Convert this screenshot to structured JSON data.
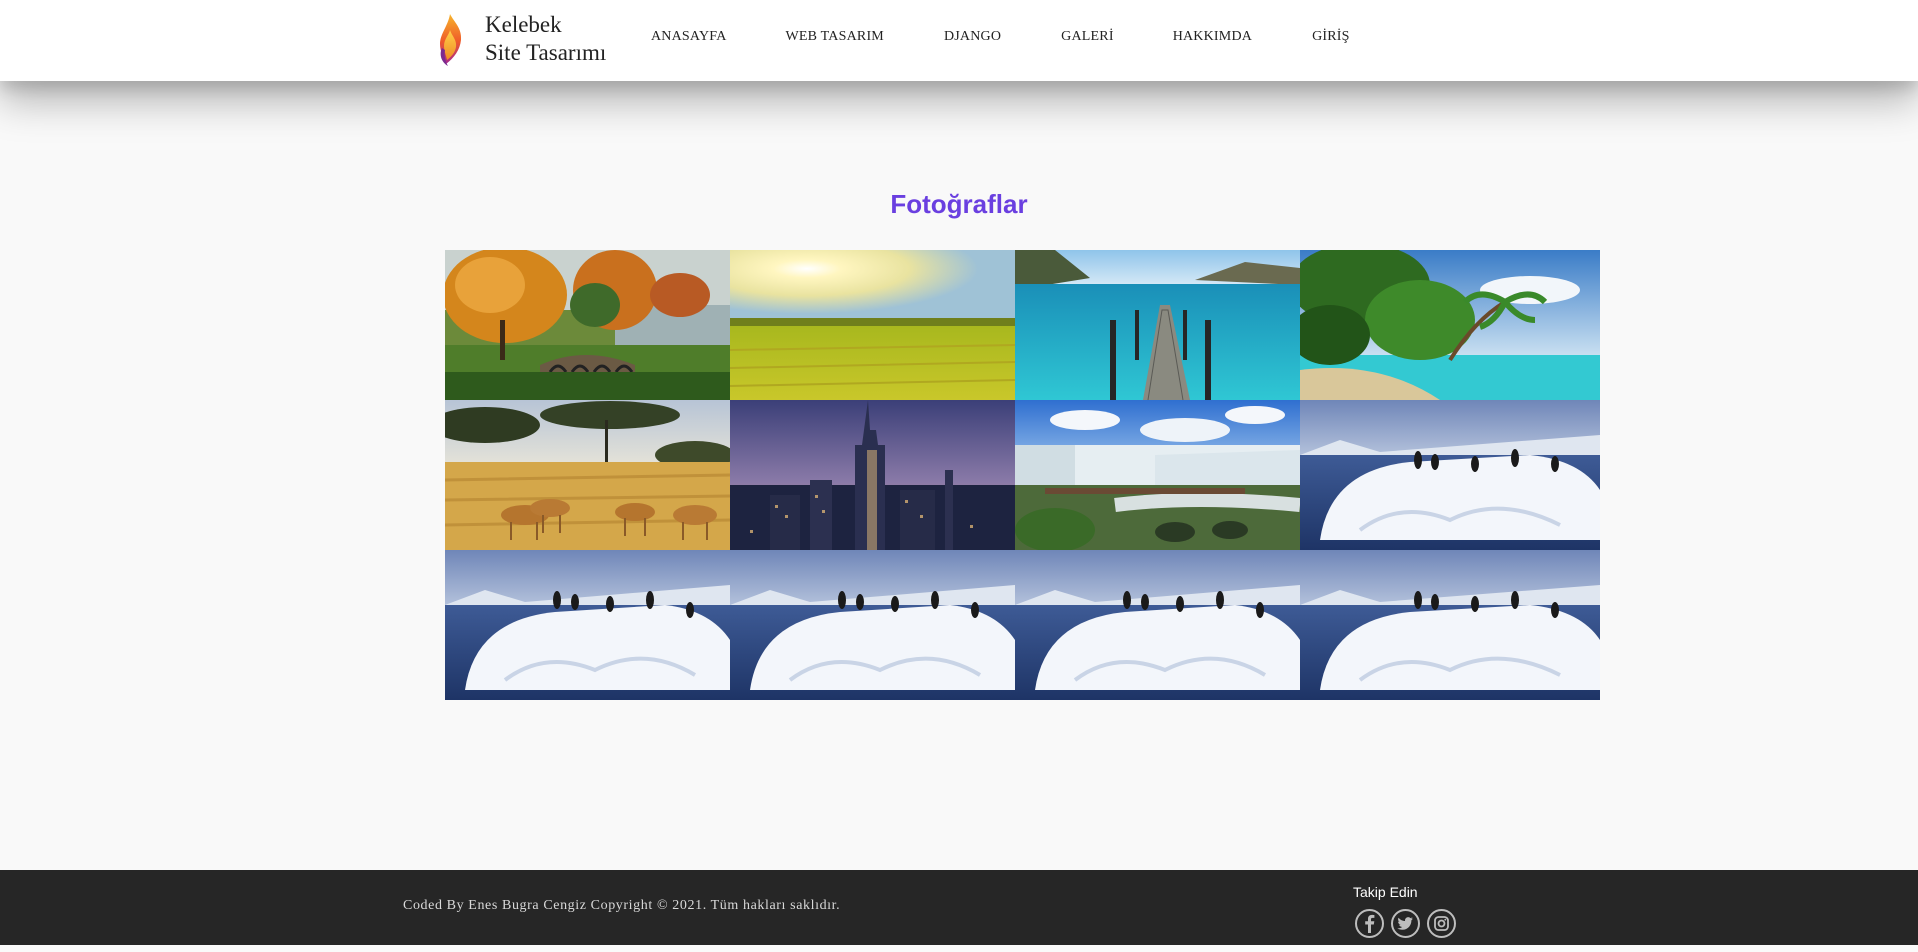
{
  "header": {
    "brand_line1": "Kelebek",
    "brand_line2": "Site Tasarımı",
    "logo_icon": "flame-logo-icon",
    "nav": [
      {
        "label": "ANASAYFA"
      },
      {
        "label": "WEB TASARIM"
      },
      {
        "label": "DJANGO"
      },
      {
        "label": "GALERİ"
      },
      {
        "label": "HAKKIMDA"
      },
      {
        "label": "GİRİŞ"
      }
    ]
  },
  "main": {
    "title": "Fotoğraflar",
    "title_color": "#6a3fe0",
    "photos": [
      {
        "scene": "autumn-park-bridge"
      },
      {
        "scene": "sunny-wheat-field"
      },
      {
        "scene": "lake-wooden-pier"
      },
      {
        "scene": "tropical-palm-beach"
      },
      {
        "scene": "savanna-gazelles"
      },
      {
        "scene": "city-skyline-dusk"
      },
      {
        "scene": "waterfalls-bridge"
      },
      {
        "scene": "penguins-iceberg"
      },
      {
        "scene": "penguins-iceberg"
      },
      {
        "scene": "penguins-iceberg"
      },
      {
        "scene": "penguins-iceberg"
      },
      {
        "scene": "penguins-iceberg"
      }
    ]
  },
  "footer": {
    "copyright": "Coded By Enes Bugra Cengiz Copyright © 2021. Tüm hakları saklıdır.",
    "follow_label": "Takip Edin",
    "socials": [
      {
        "icon": "facebook-icon"
      },
      {
        "icon": "twitter-icon"
      },
      {
        "icon": "instagram-icon"
      }
    ]
  }
}
